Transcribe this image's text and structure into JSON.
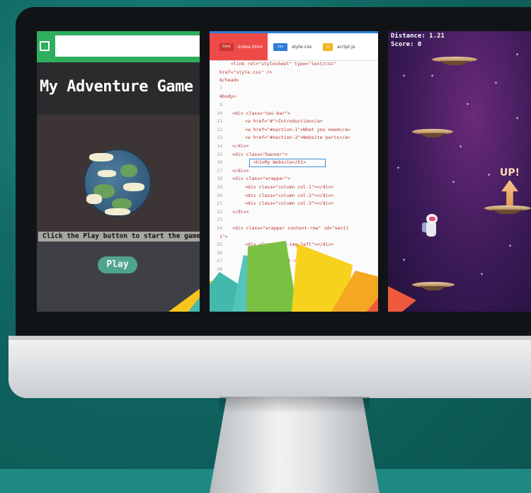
{
  "adventure_panel": {
    "title": "My Adventure Game",
    "instruction": "Click the Play button to start the game",
    "play_label": "Play"
  },
  "editor_panel": {
    "tabs": [
      {
        "badge": "html",
        "label": "index.html",
        "badge_color": "#ee4a47"
      },
      {
        "badge": "css",
        "label": "style.css",
        "badge_color": "#2e7ed8"
      },
      {
        "badge": "js",
        "label": "script.js",
        "badge_color": "#f2b61d"
      }
    ],
    "lines": [
      {
        "num": "",
        "code": "<link rel=\"stylesheet\" type=\"text/css\""
      },
      {
        "num": "",
        "code": "href=\"style.css\" />"
      },
      {
        "num": "6",
        "code": "</head>"
      },
      {
        "num": "7",
        "code": ""
      },
      {
        "num": "8",
        "code": "<body>"
      },
      {
        "num": "9",
        "code": ""
      },
      {
        "num": "10",
        "code": "    <div class=\"nav-bar\">"
      },
      {
        "num": "11",
        "code": "        <a href=\"#\">Introduction</a>"
      },
      {
        "num": "12",
        "code": "        <a href=\"#section-1\">What you need</a>"
      },
      {
        "num": "13",
        "code": "        <a href=\"#section-2\">Website parts</a>"
      },
      {
        "num": "14",
        "code": "    </div>"
      },
      {
        "num": "15",
        "code": "    <div class=\"banner\">"
      },
      {
        "num": "16",
        "code": "        <h1>My Website</h1>"
      },
      {
        "num": "17",
        "code": "    </div>"
      },
      {
        "num": "18",
        "code": "    <div class=\"wrapper\">"
      },
      {
        "num": "19",
        "code": "        <div class=\"column col-1\"></div>"
      },
      {
        "num": "20",
        "code": "        <div class=\"column col-2\"></div>"
      },
      {
        "num": "21",
        "code": "        <div class=\"column col-3\"></div>"
      },
      {
        "num": "22",
        "code": "    </div>"
      },
      {
        "num": "23",
        "code": ""
      },
      {
        "num": "24",
        "code": "    <div class=\"wrapper content-row\" id=\"secti"
      },
      {
        "num": "",
        "code": "1\">"
      },
      {
        "num": "25",
        "code": "        <div class=\"col-img-left\"></div>"
      },
      {
        "num": "26",
        "code": ""
      },
      {
        "num": "27",
        "code": "            ss=\"col-text-right\"></div>"
      },
      {
        "num": "28",
        "code": ""
      },
      {
        "num": "29",
        "code": ""
      }
    ]
  },
  "game_panel": {
    "distance_text": "Distance: 1.21",
    "score_text": "Score: 0",
    "up_text": "UP!"
  }
}
